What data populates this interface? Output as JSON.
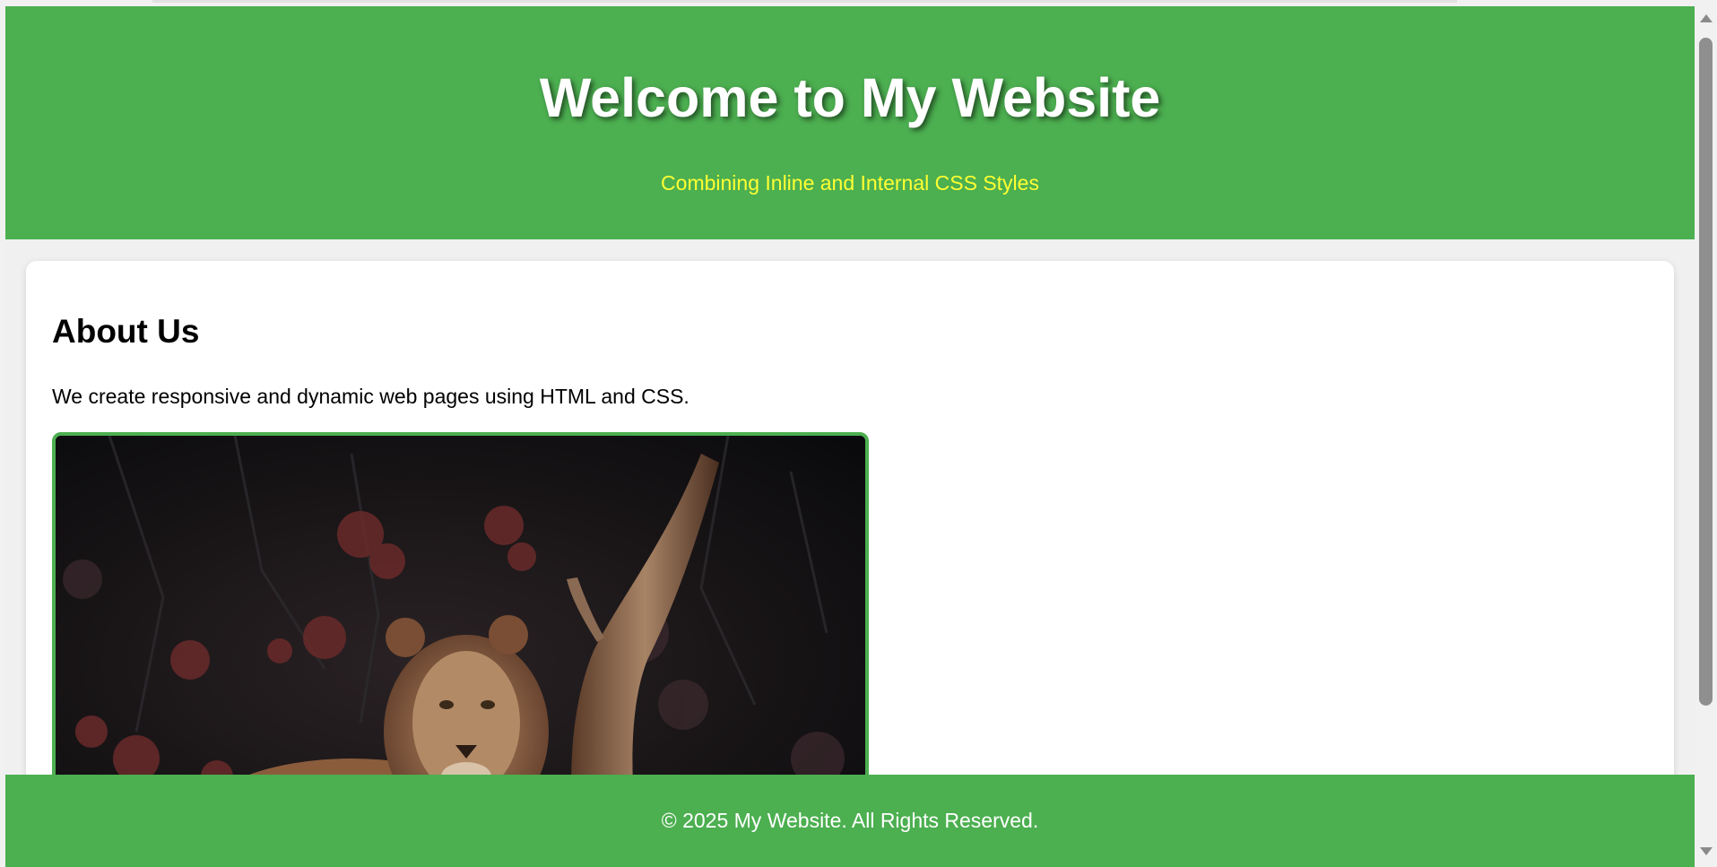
{
  "header": {
    "title": "Welcome to My Website",
    "subtitle": "Combining Inline and Internal CSS Styles"
  },
  "about": {
    "heading": "About Us",
    "text": "We create responsive and dynamic web pages using HTML and CSS.",
    "image": "lion-photo"
  },
  "footer": {
    "text": "© 2025 My Website. All Rights Reserved."
  },
  "colors": {
    "accent": "#4caf50",
    "subtitle": "#ffff33",
    "background": "#f0f0f0",
    "card": "#ffffff"
  },
  "scrollbar": {
    "position_fraction": 0.0
  }
}
